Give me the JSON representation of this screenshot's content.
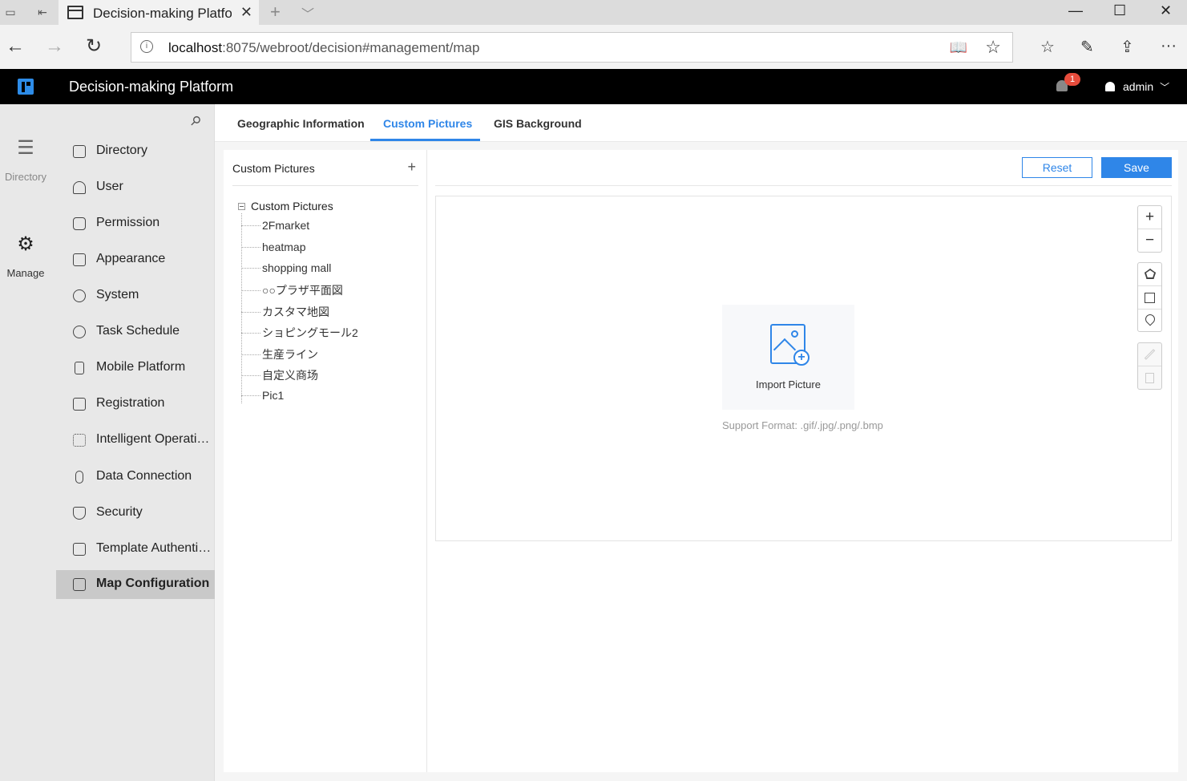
{
  "browser": {
    "tab_title": "Decision-making Platfor",
    "url_host": "localhost",
    "url_rest": ":8075/webroot/decision#management/map"
  },
  "app": {
    "title": "Decision-making Platform",
    "notification_count": "1",
    "user": "admin"
  },
  "rail": {
    "directory_label": "Directory",
    "manage_label": "Manage"
  },
  "menu": {
    "items": [
      {
        "label": "Directory",
        "icon": "directory-icon"
      },
      {
        "label": "User",
        "icon": "user-icon"
      },
      {
        "label": "Permission",
        "icon": "lock-icon"
      },
      {
        "label": "Appearance",
        "icon": "paint-roller-icon"
      },
      {
        "label": "System",
        "icon": "gear-icon"
      },
      {
        "label": "Task Schedule",
        "icon": "stopwatch-icon"
      },
      {
        "label": "Mobile Platform",
        "icon": "mobile-icon"
      },
      {
        "label": "Registration",
        "icon": "registration-icon"
      },
      {
        "label": "Intelligent Operations",
        "icon": "network-icon"
      },
      {
        "label": "Data Connection",
        "icon": "paperclip-icon"
      },
      {
        "label": "Security",
        "icon": "shield-icon"
      },
      {
        "label": "Template Authentic…",
        "icon": "template-icon"
      },
      {
        "label": "Map Configuration",
        "icon": "map-icon",
        "active": true
      }
    ]
  },
  "tabs": {
    "geo": "Geographic Information",
    "custom": "Custom Pictures",
    "gis": "GIS Background"
  },
  "tree": {
    "header": "Custom Pictures",
    "root": "Custom Pictures",
    "nodes": [
      "2Fmarket",
      "heatmap",
      "shopping mall",
      "○○プラザ平面図",
      "カスタマ地図",
      "ショピングモール2",
      "生産ライン",
      "自定义商场",
      "Pic1"
    ]
  },
  "toolbar": {
    "reset": "Reset",
    "save": "Save"
  },
  "canvas": {
    "import_label": "Import Picture",
    "support": "Support Format: .gif/.jpg/.png/.bmp"
  },
  "colors": {
    "accent": "#2f86e8",
    "badge": "#e64c3c"
  }
}
